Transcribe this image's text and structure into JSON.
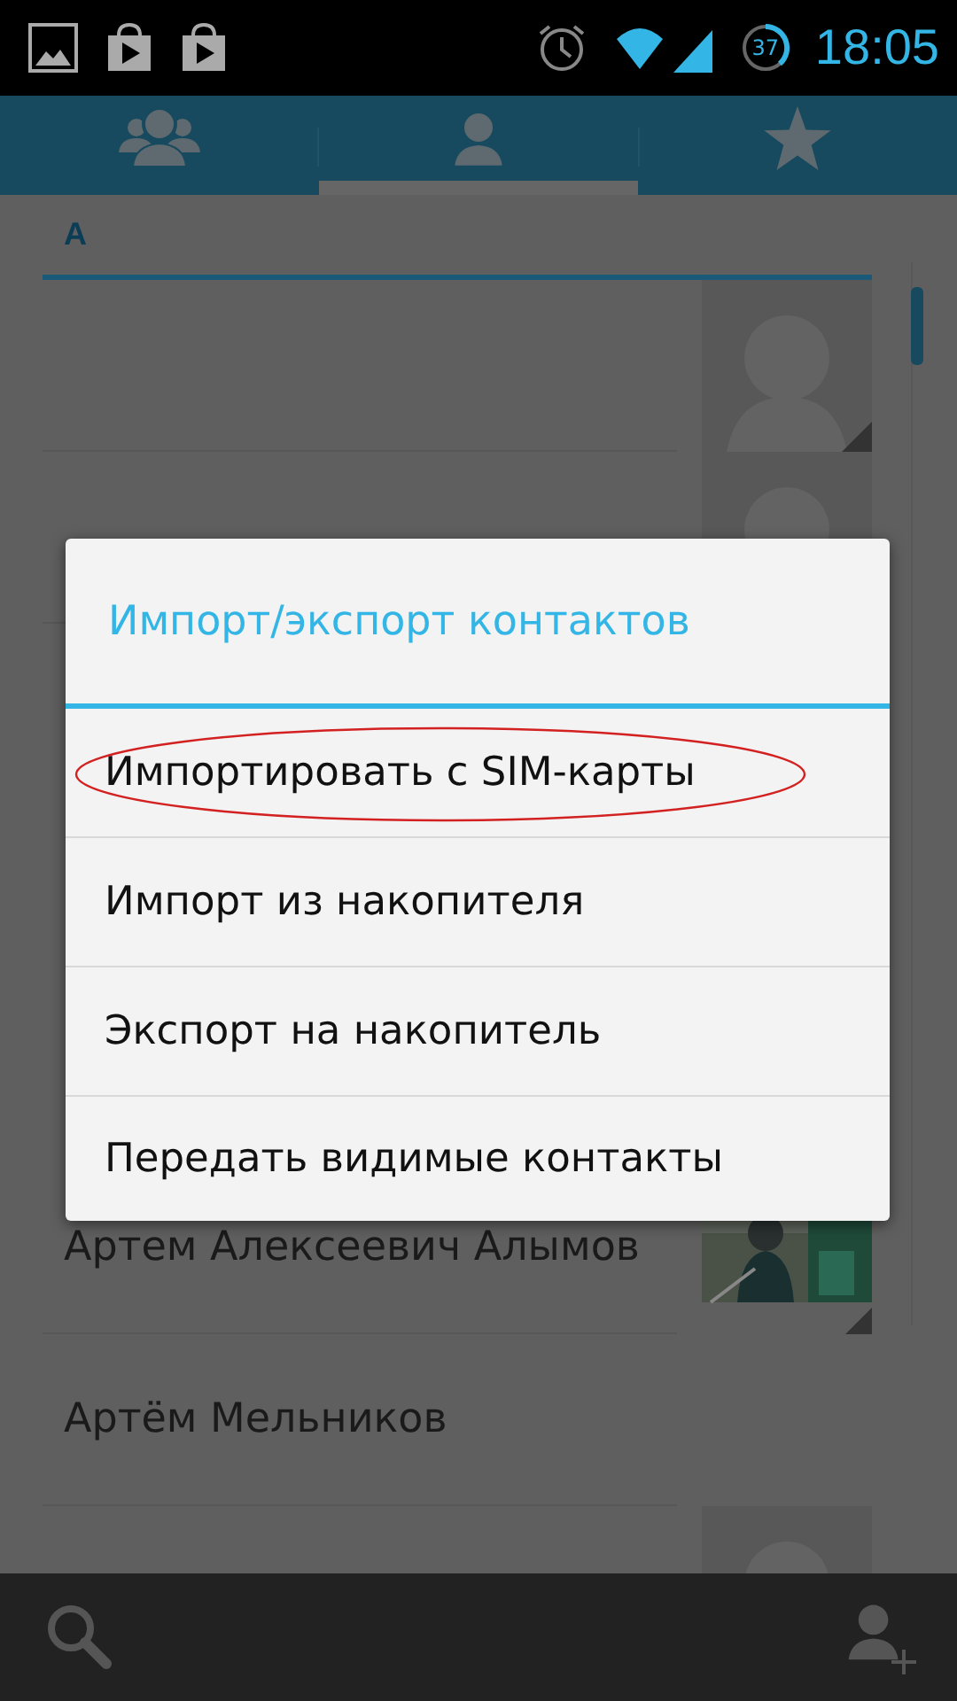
{
  "status_bar": {
    "notifications": [
      {
        "kind": "gallery"
      },
      {
        "kind": "store"
      },
      {
        "kind": "store"
      }
    ],
    "battery": "37",
    "time": "18:05"
  },
  "tabs": [
    {
      "kind": "groups",
      "selected": false
    },
    {
      "kind": "contacts",
      "selected": true
    },
    {
      "kind": "favorites",
      "selected": false
    }
  ],
  "contact_list": {
    "section": "A",
    "top_rows": [
      {
        "kind": "placeholder"
      },
      {
        "kind": "placeholder"
      }
    ],
    "bottom_rows": [
      {
        "name": "Артем Алексеевич Алымов"
      },
      {
        "name": "Артём Мельников"
      },
      {
        "kind": "placeholder"
      }
    ]
  },
  "dialog": {
    "title": "Импорт/экспорт контактов",
    "items": [
      {
        "label": "Импортировать с SIM-карты",
        "circled": true
      },
      {
        "label": "Импорт из накопителя",
        "circled": false
      },
      {
        "label": "Экспорт на накопитель",
        "circled": false
      },
      {
        "label": "Передать видимые контакты",
        "circled": false
      }
    ]
  }
}
